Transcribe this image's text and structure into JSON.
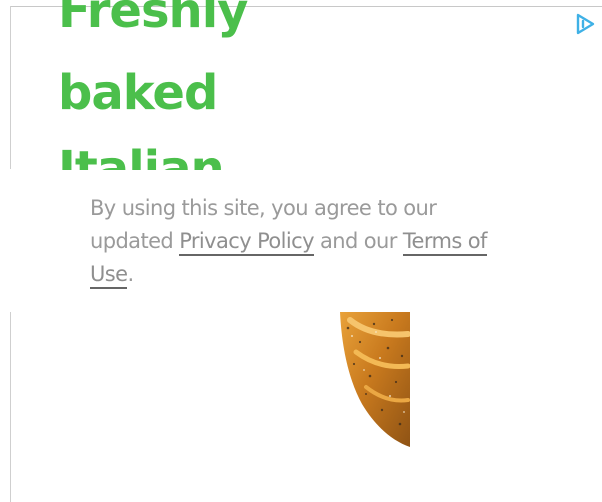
{
  "ad": {
    "headline_lines": [
      "Freshly",
      "baked",
      "Italian"
    ],
    "headline_color": "#4bbf4b",
    "icon": "adchoices-triangle-icon",
    "icon_color": "#3fb1e6",
    "image": "bread-loaf-image"
  },
  "consent": {
    "prefix": "By using this site, you agree to our updated ",
    "privacy_link": "Privacy Policy",
    "middle": " and our ",
    "terms_link": "Terms of Use",
    "suffix": ".",
    "text_color": "#9a9a9a"
  }
}
